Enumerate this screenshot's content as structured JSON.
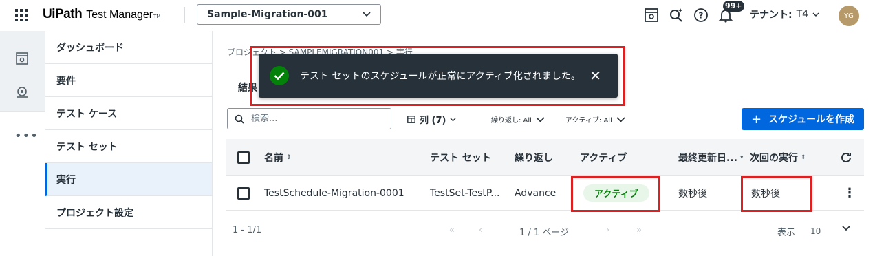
{
  "header": {
    "brand": "UiPath",
    "product": "Test Manager",
    "trademark": "TM",
    "project_select": "Sample-Migration-001",
    "notifications_badge": "99+",
    "tenant_label": "テナント:",
    "tenant_value": "T4",
    "avatar_initials": "YG"
  },
  "sidebar": {
    "items": [
      {
        "label": "ダッシュボード"
      },
      {
        "label": "要件"
      },
      {
        "label": "テスト ケース"
      },
      {
        "label": "テスト セット"
      },
      {
        "label": "実行",
        "active": true
      },
      {
        "label": "プロジェクト設定"
      }
    ]
  },
  "breadcrumb": "プロジェクト > SAMPLEMIGRATION001 > 実行",
  "tab_partial": "結果",
  "toast": {
    "message": "テスト セットのスケジュールが正常にアクティブ化されました。"
  },
  "toolbar": {
    "search_placeholder": "検索...",
    "columns_label": "列 (7)",
    "filter_repeat": "繰り返し: All",
    "filter_active": "アクティブ: All",
    "create_label": "スケジュールを作成"
  },
  "table": {
    "headers": {
      "name": "名前",
      "test_set": "テスト セット",
      "repeat": "繰り返し",
      "active": "アクティブ",
      "last_updated": "最終更新日...",
      "next_run": "次回の実行"
    },
    "rows": [
      {
        "name": "TestSchedule-Migration-0001",
        "test_set": "TestSet-TestP...",
        "repeat": "Advance",
        "active": "アクティブ",
        "last_updated": "数秒後",
        "next_run": "数秒後"
      }
    ]
  },
  "pager": {
    "range": "1 - 1/1",
    "page": "1 / 1 ページ",
    "page_size_label": "表示",
    "page_size": "10"
  },
  "colors": {
    "primary": "#0067df",
    "toast_bg": "#273139",
    "success": "#038108",
    "highlight": "#e02020"
  }
}
